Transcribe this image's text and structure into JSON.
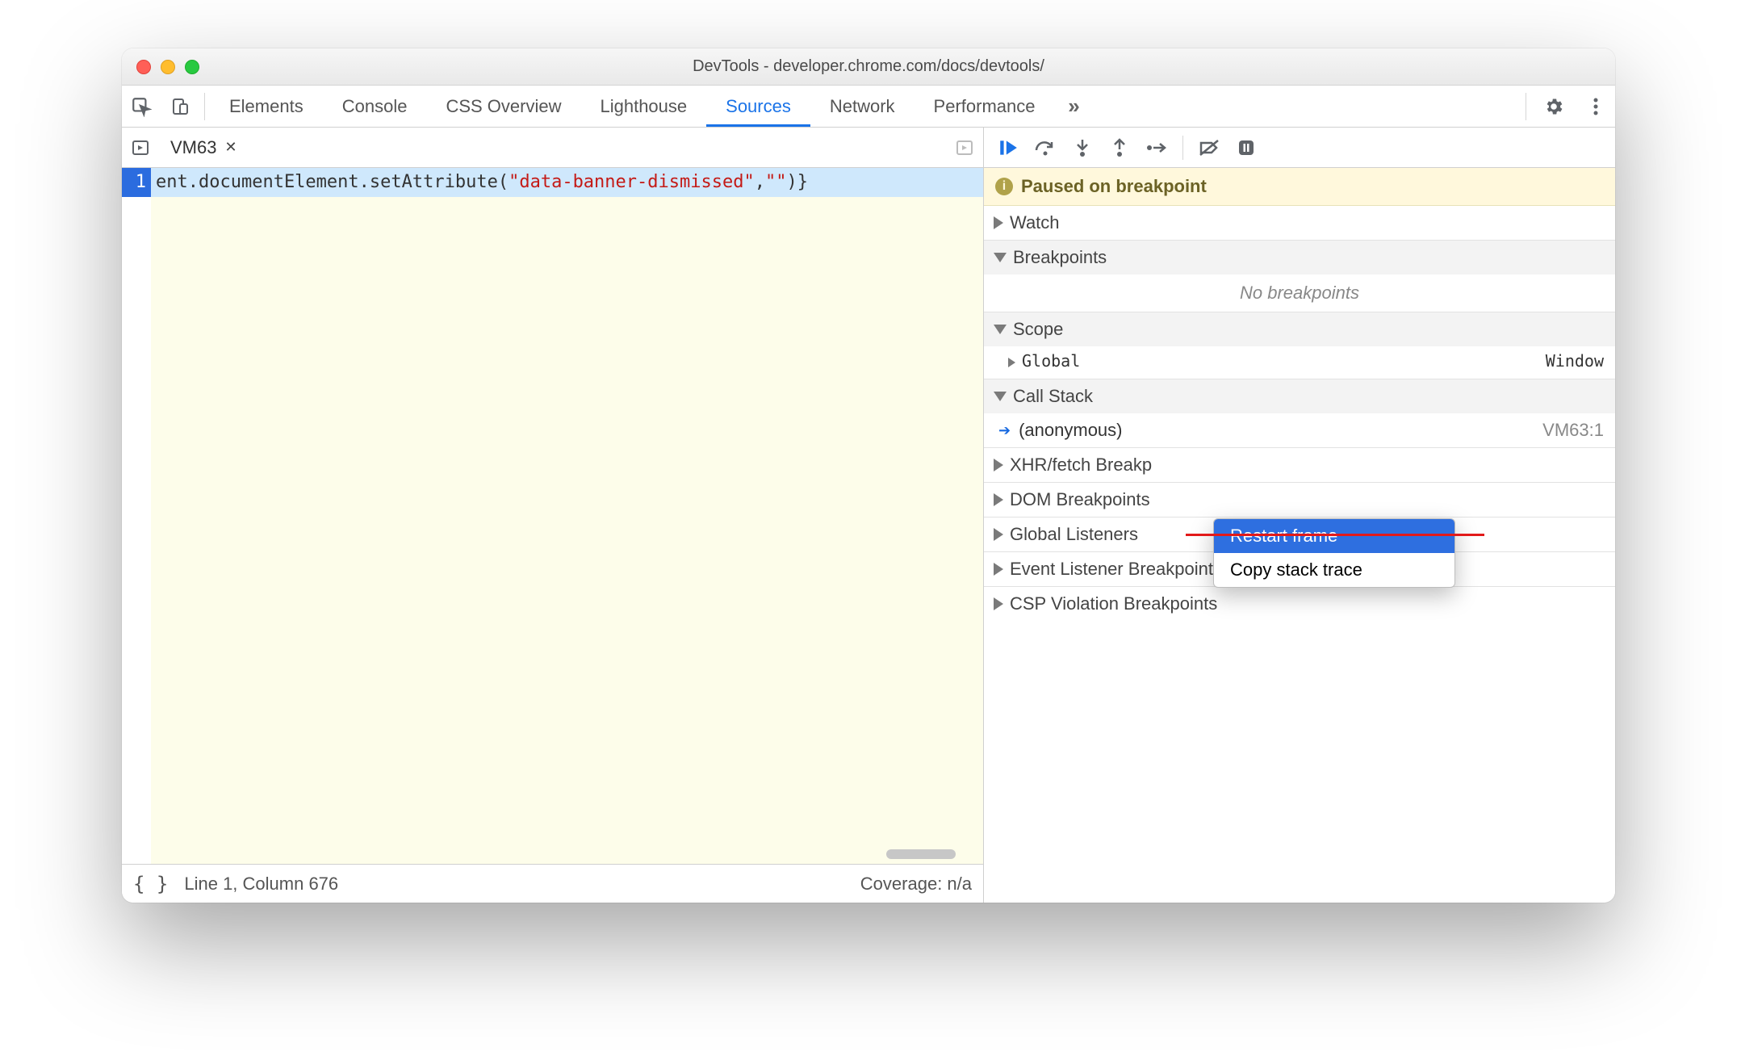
{
  "window": {
    "title": "DevTools - developer.chrome.com/docs/devtools/"
  },
  "tabs": {
    "items": [
      "Elements",
      "Console",
      "CSS Overview",
      "Lighthouse",
      "Sources",
      "Network",
      "Performance"
    ],
    "active_index": 4,
    "overflow_icon": "chevron-right-double-icon"
  },
  "editor": {
    "file_tab": "VM63",
    "line_number": "1",
    "code_prefix": "ent.documentElement.setAttribute(",
    "code_string": "\"data-banner-dismissed\"",
    "code_mid": ",",
    "code_string2": "\"\"",
    "code_suffix": ")}",
    "status_left": "Line 1, Column 676",
    "status_right": "Coverage: n/a",
    "braces": "{ }"
  },
  "debugger": {
    "paused_text": "Paused on breakpoint",
    "sections": {
      "watch": "Watch",
      "breakpoints": "Breakpoints",
      "no_breakpoints": "No breakpoints",
      "scope": "Scope",
      "scope_global": "Global",
      "scope_global_value": "Window",
      "callstack": "Call Stack",
      "frame_name": "(anonymous)",
      "frame_loc": "VM63:1",
      "xhr": "XHR/fetch Breakp",
      "dom": "DOM Breakpoints",
      "global_listeners": "Global Listeners",
      "event_listener_bp": "Event Listener Breakpoints",
      "csp": "CSP Violation Breakpoints"
    }
  },
  "context_menu": {
    "item1": "Restart frame",
    "item2": "Copy stack trace"
  }
}
